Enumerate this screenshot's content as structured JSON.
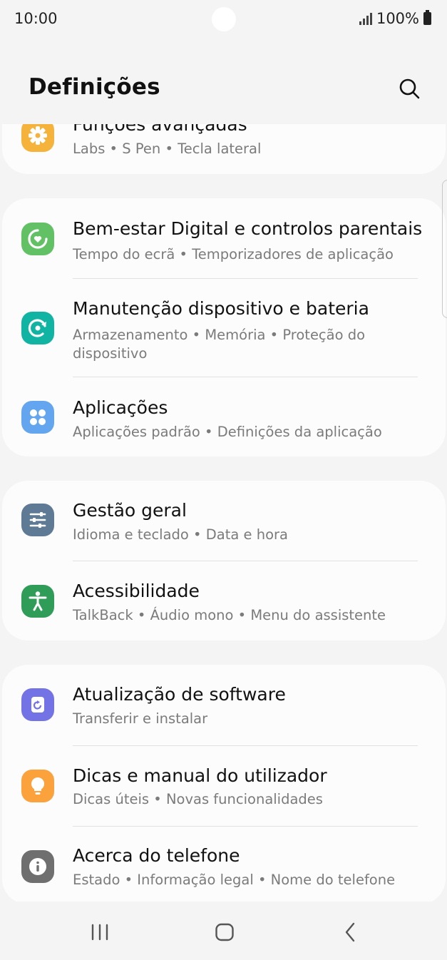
{
  "status_bar": {
    "time": "10:00",
    "battery": "100%"
  },
  "header": {
    "title": "Definições"
  },
  "items": [
    {
      "title": "Funções avançadas",
      "subtitle": "Labs  •  S Pen  •  Tecla lateral",
      "icon": "gear-icon",
      "icon_color": "#f6b33c"
    },
    {
      "title": "Bem-estar Digital e controlos parentais",
      "subtitle": "Tempo do ecrã  •  Temporizadores de aplicação",
      "icon": "digital-wellbeing-icon",
      "icon_color": "#62c164"
    },
    {
      "title": "Manutenção dispositivo e bateria",
      "subtitle": "Armazenamento  •  Memória  •  Proteção do dispositivo",
      "icon": "device-care-icon",
      "icon_color": "#11b3a2"
    },
    {
      "title": "Aplicações",
      "subtitle": "Aplicações padrão  •  Definições da aplicação",
      "icon": "apps-icon",
      "icon_color": "#63a6ef"
    },
    {
      "title": "Gestão geral",
      "subtitle": "Idioma e teclado  •  Data e hora",
      "icon": "sliders-icon",
      "icon_color": "#5f7a94"
    },
    {
      "title": "Acessibilidade",
      "subtitle": "TalkBack  •  Áudio mono  •  Menu do assistente",
      "icon": "accessibility-icon",
      "icon_color": "#2f9c57"
    },
    {
      "title": "Atualização de software",
      "subtitle": "Transferir e instalar",
      "icon": "software-update-icon",
      "icon_color": "#7473e6"
    },
    {
      "title": "Dicas e manual do utilizador",
      "subtitle": "Dicas úteis  •  Novas funcionalidades",
      "icon": "lightbulb-icon",
      "icon_color": "#fba23d"
    },
    {
      "title": "Acerca do telefone",
      "subtitle": "Estado  •  Informação legal  •  Nome do telefone",
      "icon": "info-icon",
      "icon_color": "#6f6f6f"
    }
  ],
  "navbar": {
    "icons": [
      "recent-apps-icon",
      "home-icon",
      "back-icon"
    ]
  }
}
